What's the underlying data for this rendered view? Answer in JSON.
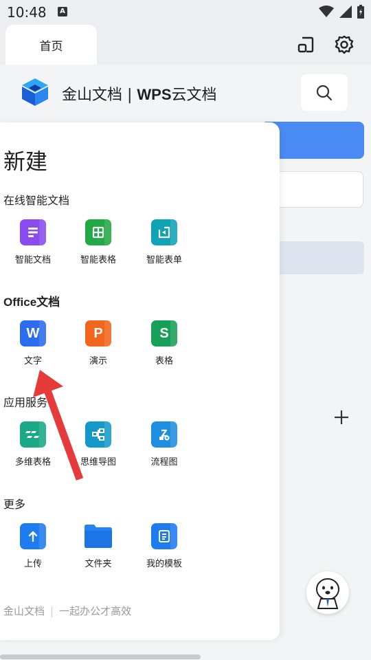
{
  "status": {
    "time": "10:48",
    "notification_icon": "A"
  },
  "tabs": [
    {
      "label": "首页"
    }
  ],
  "header": {
    "brand_prefix": "金山文档 | ",
    "brand_bold": "WPS",
    "brand_suffix": "云文档"
  },
  "panel": {
    "title": "新建",
    "sections": [
      {
        "title": "在线智能文档",
        "items": [
          {
            "label": "智能文档",
            "icon": "smart-doc-icon",
            "color": "#8a4bf0"
          },
          {
            "label": "智能表格",
            "icon": "smart-sheet-icon",
            "color": "#22a845"
          },
          {
            "label": "智能表单",
            "icon": "smart-form-icon",
            "color": "#10a3b5"
          }
        ]
      },
      {
        "title": "Office文档",
        "items": [
          {
            "label": "文字",
            "icon": "word-icon",
            "glyph": "W",
            "color": "#2b6cf0"
          },
          {
            "label": "演示",
            "icon": "ppt-icon",
            "glyph": "P",
            "color": "#f2651c"
          },
          {
            "label": "表格",
            "icon": "sheet-icon",
            "glyph": "S",
            "color": "#18a058"
          }
        ]
      },
      {
        "title": "应用服务",
        "items": [
          {
            "label": "多维表格",
            "icon": "multi-table-icon",
            "color": "#19a986"
          },
          {
            "label": "思维导图",
            "icon": "mindmap-icon",
            "color": "#1399c9"
          },
          {
            "label": "流程图",
            "icon": "flowchart-icon",
            "color": "#1e8fe0"
          }
        ]
      },
      {
        "title": "更多",
        "items": [
          {
            "label": "上传",
            "icon": "upload-icon",
            "color": "#1f7cf0"
          },
          {
            "label": "文件夹",
            "icon": "folder-icon",
            "color": "#2683f2"
          },
          {
            "label": "我的模板",
            "icon": "template-icon",
            "color": "#1f7cf0"
          }
        ]
      }
    ],
    "footer_left": "金山文档",
    "footer_sep": "|",
    "footer_right": "一起办公才高效"
  },
  "colors": {
    "accent": "#4b8bf5",
    "arrow": "#e53b3b"
  }
}
